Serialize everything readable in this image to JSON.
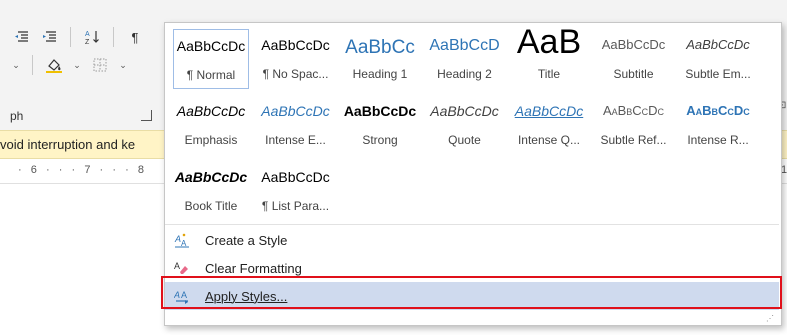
{
  "ribbon": {
    "group_label": "ph",
    "sort_icon": "sort-az-icon",
    "pilcrow_label": "¶"
  },
  "banner": {
    "text": "void interruption and ke"
  },
  "ruler": {
    "text": "·  6  ·  ·  ·  7  ·  ·  ·  8",
    "right_marker": "1"
  },
  "gallery": {
    "styles": [
      {
        "preview": "AaBbCcDc",
        "name": "¶ Normal",
        "selected": true
      },
      {
        "preview": "AaBbCcDc",
        "name": "¶ No Spac..."
      },
      {
        "preview": "AaBbCc",
        "name": "Heading 1"
      },
      {
        "preview": "AaBbCcD",
        "name": "Heading 2"
      },
      {
        "preview": "AaB",
        "name": "Title"
      },
      {
        "preview": "AaBbCcDc",
        "name": "Subtitle"
      },
      {
        "preview": "AaBbCcDc",
        "name": "Subtle Em..."
      },
      {
        "preview": "AaBbCcDc",
        "name": "Emphasis"
      },
      {
        "preview": "AaBbCcDc",
        "name": "Intense E..."
      },
      {
        "preview": "AaBbCcDc",
        "name": "Strong"
      },
      {
        "preview": "AaBbCcDc",
        "name": "Quote"
      },
      {
        "preview": "AaBbCcDc",
        "name": "Intense Q..."
      },
      {
        "preview": "AaBbCcDc",
        "name": "Subtle Ref..."
      },
      {
        "preview": "AaBbCcDc",
        "name": "Intense R..."
      },
      {
        "preview": "AaBbCcDc",
        "name": "Book Title"
      },
      {
        "preview": "AaBbCcDc",
        "name": "¶ List Para..."
      }
    ]
  },
  "menu": {
    "create_style": "Create a Style",
    "clear_formatting": "Clear Formatting",
    "apply_styles": "Apply Styles..."
  },
  "colors": {
    "heading_blue": "#2e74b5",
    "selected_border": "#9fbde6",
    "hover_bg": "#cfdaee",
    "annotation_red": "#e0101a",
    "banner_bg": "#fff4c6"
  }
}
